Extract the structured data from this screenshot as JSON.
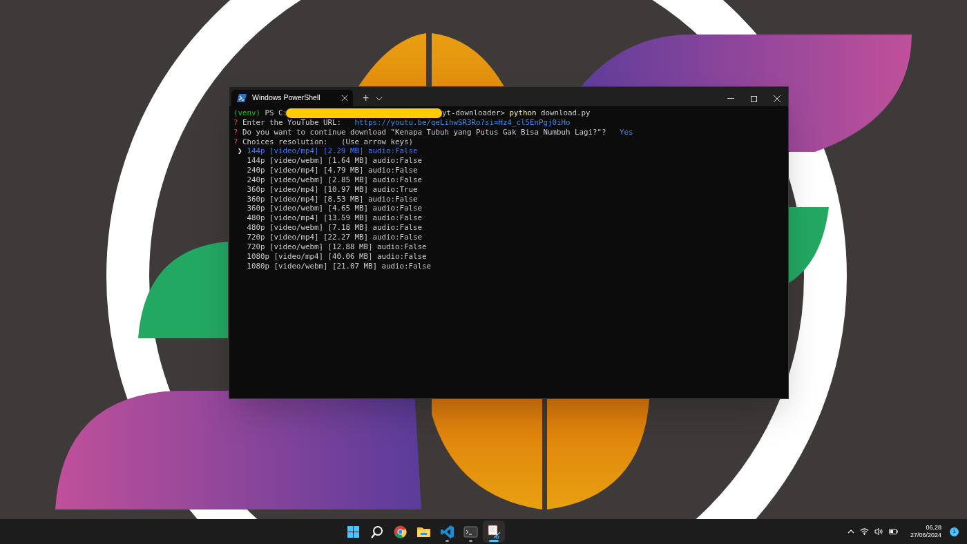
{
  "window": {
    "tab_title": "Windows PowerShell",
    "new_tab": "+"
  },
  "terminal": {
    "prompt": {
      "env": "(venv)",
      "ps": "PS C:",
      "path_tail": "yt-downloader>",
      "command": "python",
      "args": "download.py"
    },
    "questions": [
      {
        "mark": "?",
        "label": "Enter the YouTube URL:",
        "answer": "https://youtu.be/qeLihwSR3Ro?si=Hz4_cl5EnPgj0iHo",
        "kind": "answered"
      },
      {
        "mark": "?",
        "label": "Do you want to continue download \"Kenapa Tubuh yang Putus Gak Bisa Numbuh Lagi?\"?",
        "answer": "Yes",
        "kind": "answered"
      },
      {
        "mark": "?",
        "label": "Choices resolution:",
        "hint": "(Use arrow keys)",
        "kind": "pending"
      }
    ],
    "pointer": "❯",
    "options": [
      {
        "text": "144p [video/mp4] [2.29 MB] audio:False",
        "selected": true
      },
      {
        "text": "144p [video/webm] [1.64 MB] audio:False",
        "selected": false
      },
      {
        "text": "240p [video/mp4] [4.79 MB] audio:False",
        "selected": false
      },
      {
        "text": "240p [video/webm] [2.85 MB] audio:False",
        "selected": false
      },
      {
        "text": "360p [video/mp4] [10.97 MB] audio:True",
        "selected": false
      },
      {
        "text": "360p [video/mp4] [8.53 MB] audio:False",
        "selected": false
      },
      {
        "text": "360p [video/webm] [4.65 MB] audio:False",
        "selected": false
      },
      {
        "text": "480p [video/mp4] [13.59 MB] audio:False",
        "selected": false
      },
      {
        "text": "480p [video/webm] [7.18 MB] audio:False",
        "selected": false
      },
      {
        "text": "720p [video/mp4] [22.27 MB] audio:False",
        "selected": false
      },
      {
        "text": "720p [video/webm] [12.88 MB] audio:False",
        "selected": false
      },
      {
        "text": "1080p [video/mp4] [40.06 MB] audio:False",
        "selected": false
      },
      {
        "text": "1080p [video/webm] [21.07 MB] audio:False",
        "selected": false
      }
    ]
  },
  "taskbar": {
    "items": [
      {
        "kind": "start",
        "running": false,
        "active": false
      },
      {
        "kind": "search",
        "running": false,
        "active": false
      },
      {
        "kind": "browser",
        "running": false,
        "active": false
      },
      {
        "kind": "folder",
        "running": false,
        "active": false
      },
      {
        "kind": "editor",
        "running": true,
        "active": false
      },
      {
        "kind": "terminal",
        "running": true,
        "active": false
      },
      {
        "kind": "snip",
        "running": true,
        "active": true
      }
    ],
    "time": "06.28",
    "date": "27/06/2024",
    "notification_count": "1"
  }
}
